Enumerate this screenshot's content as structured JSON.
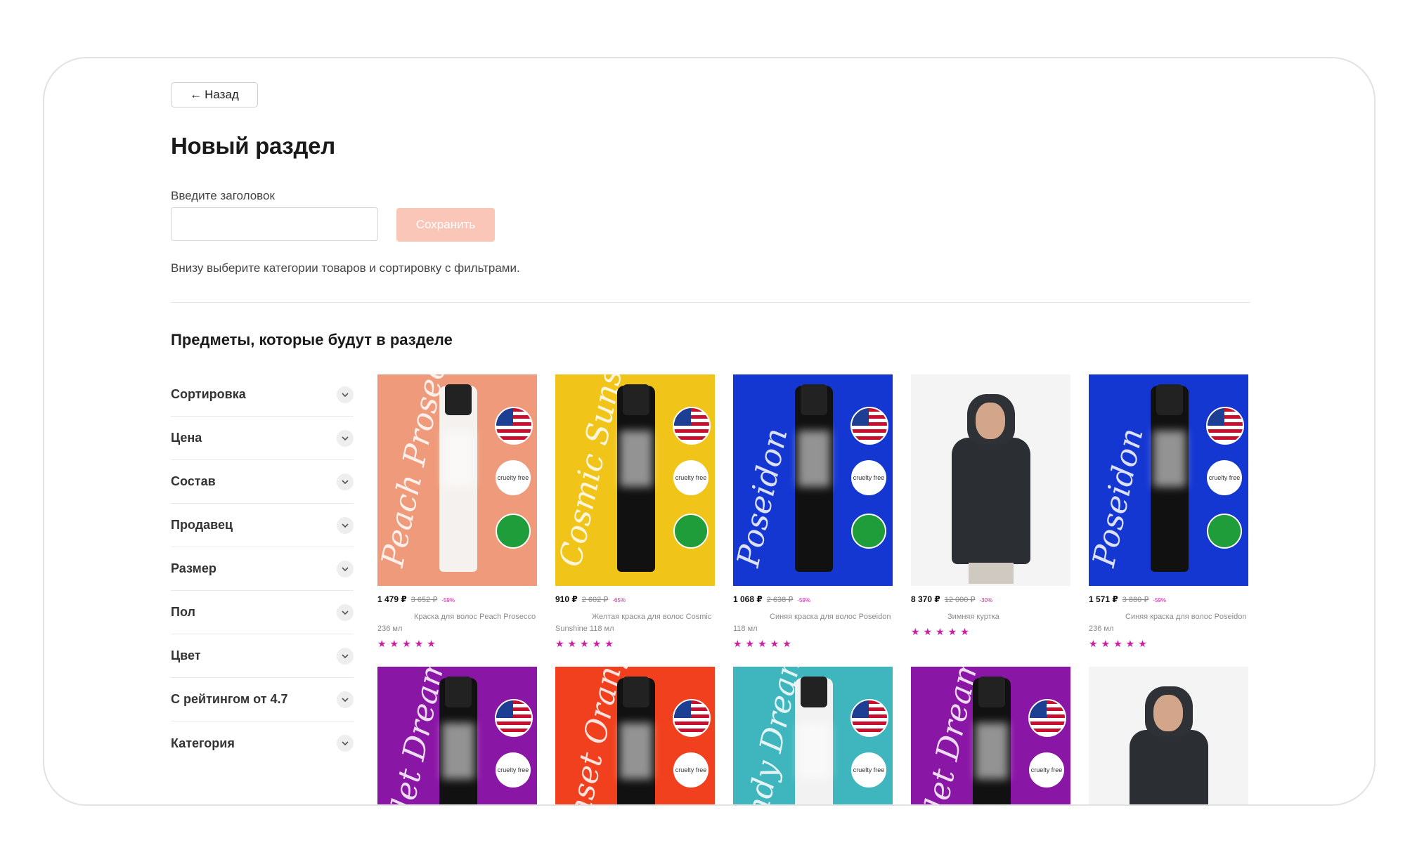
{
  "back_button": {
    "arrow": "←",
    "label": "Назад"
  },
  "page_title": "Новый раздел",
  "title_field": {
    "label": "Введите заголовок",
    "value": "",
    "placeholder": ""
  },
  "save_button": {
    "label": "Сохранить",
    "disabled": true,
    "color": "#f9c6b8"
  },
  "hint": "Внизу выберите категории товаров и сортировку с фильтрами.",
  "section_title": "Предметы, которые будут в разделе",
  "filters": [
    {
      "label": "Сортировка"
    },
    {
      "label": "Цена"
    },
    {
      "label": "Состав"
    },
    {
      "label": "Продавец"
    },
    {
      "label": "Размер"
    },
    {
      "label": "Пол"
    },
    {
      "label": "Цвет"
    },
    {
      "label": "С рейтингом от 4.7"
    },
    {
      "label": "Категория"
    }
  ],
  "products": [
    {
      "image": "hair-dye-bottle",
      "image_text": "Peach Prosecco",
      "bg": "#ef9a7a",
      "bottle": "#f4f1ee",
      "price": "1 479 ₽",
      "old_price": "3 652 ₽",
      "discount": "-59%",
      "name": "Краска для волос Peach Prosecco 236 мл",
      "stars": "★★★★★"
    },
    {
      "image": "hair-dye-bottle",
      "image_text": "Cosmic Sunshine",
      "bg": "#f0c419",
      "bottle": "#111111",
      "price": "910 ₽",
      "old_price": "2 602 ₽",
      "discount": "-65%",
      "name": "Желтая краска для волос Cosmic Sunshine 118 мл",
      "stars": "★★★★★"
    },
    {
      "image": "hair-dye-bottle",
      "image_text": "Poseidon",
      "bg": "#1537d1",
      "bottle": "#111111",
      "price": "1 068 ₽",
      "old_price": "2 638 ₽",
      "discount": "-59%",
      "name": "Синяя краска для волос Poseidon 118 мл",
      "stars": "★★★★★"
    },
    {
      "image": "winter-jacket-photo",
      "image_text": "",
      "bg": "#f4f4f4",
      "bottle": "",
      "price": "8 370 ₽",
      "old_price": "12 000 ₽",
      "discount": "-30%",
      "name": "Зимняя куртка",
      "stars": "★★★★★"
    },
    {
      "image": "hair-dye-bottle",
      "image_text": "Poseidon",
      "bg": "#1537d1",
      "bottle": "#111111",
      "price": "1 571 ₽",
      "old_price": "3 880 ₽",
      "discount": "-59%",
      "name": "Синяя краска для волос Poseidon 236 мл",
      "stars": "★★★★★"
    },
    {
      "image": "hair-dye-bottle",
      "image_text": "Violet Dream",
      "bg": "#8a16a6",
      "bottle": "#111111",
      "price": "",
      "old_price": "",
      "discount": "",
      "name": "",
      "stars": ""
    },
    {
      "image": "hair-dye-bottle",
      "image_text": "Sunset Orange",
      "bg": "#f0401e",
      "bottle": "#111111",
      "price": "",
      "old_price": "",
      "discount": "",
      "name": "",
      "stars": ""
    },
    {
      "image": "hair-dye-bottle",
      "image_text": "Candy Dreams",
      "bg": "#3fb6bd",
      "bottle": "#f2f2f2",
      "price": "",
      "old_price": "",
      "discount": "",
      "name": "",
      "stars": ""
    },
    {
      "image": "hair-dye-bottle",
      "image_text": "Violet Dream",
      "bg": "#8a16a6",
      "bottle": "#111111",
      "price": "",
      "old_price": "",
      "discount": "",
      "name": "",
      "stars": ""
    },
    {
      "image": "winter-jacket-photo",
      "image_text": "",
      "bg": "#f4f4f4",
      "bottle": "",
      "price": "",
      "old_price": "",
      "discount": "",
      "name": "",
      "stars": ""
    }
  ],
  "badge_text": "cruelty free",
  "accent_color": "#cc1fa1"
}
